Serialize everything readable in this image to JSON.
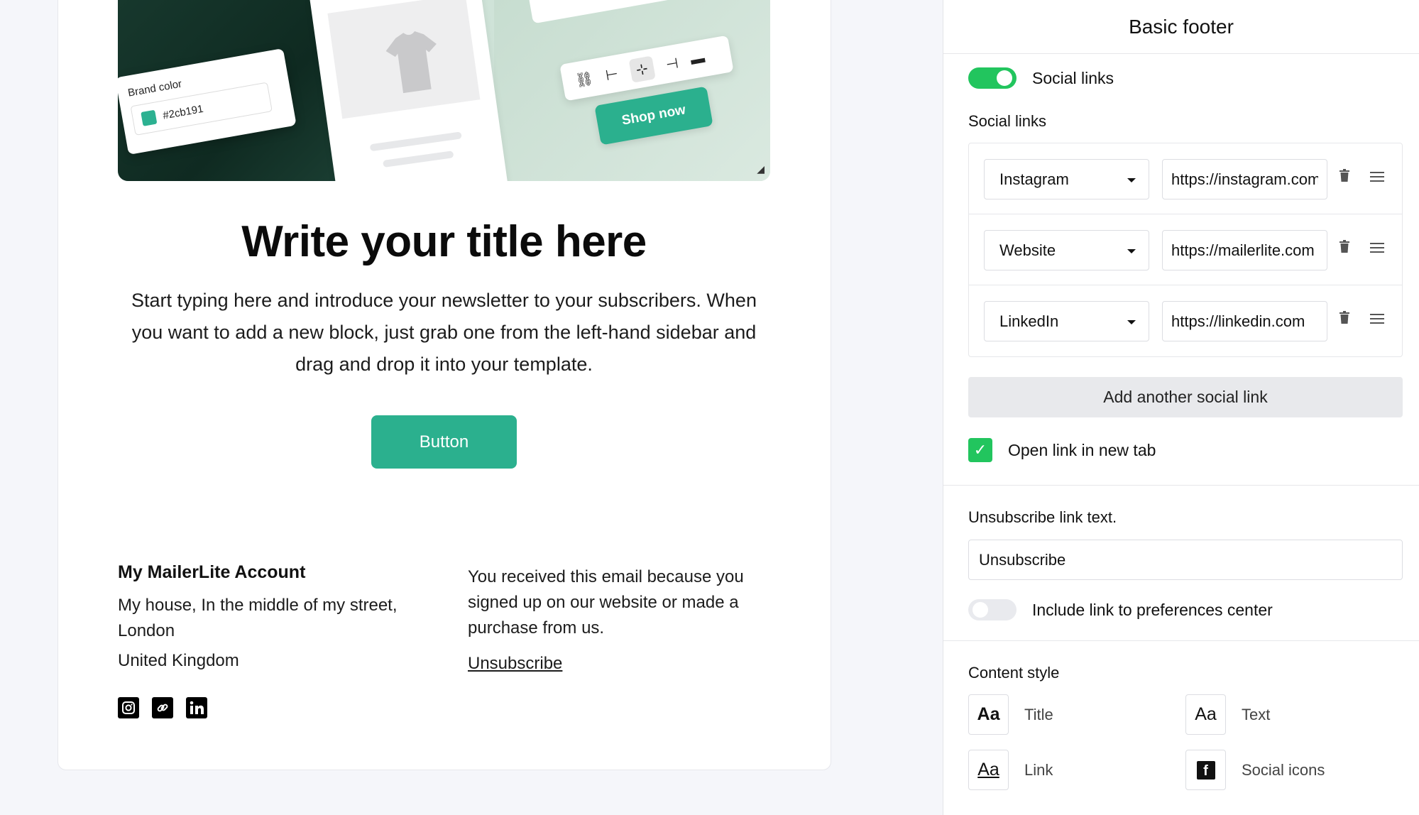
{
  "hero": {
    "brand_color_label": "Brand color",
    "brand_color_value": "#2cb191",
    "shop_button": "Shop now",
    "brand_color_hex": "#2cb191"
  },
  "email": {
    "title": "Write your title here",
    "body": "Start typing here and introduce your newsletter to your subscribers. When you want to add a new block, just grab one from the left-hand sidebar and drag and drop it into your template.",
    "button": "Button",
    "footer": {
      "account": "My MailerLite Account",
      "address": "My house, In the middle of my street, London",
      "country": "United Kingdom",
      "notice": "You received this email because you signed up on our website or made a purchase from us.",
      "unsubscribe": "Unsubscribe",
      "social_icons": [
        "instagram-icon",
        "link-icon",
        "linkedin-icon"
      ]
    }
  },
  "panel": {
    "title": "Basic footer",
    "social_toggle_label": "Social links",
    "social_toggle_on": true,
    "social_section_label": "Social links",
    "links": [
      {
        "network": "Instagram",
        "url": "https://instagram.com"
      },
      {
        "network": "Website",
        "url": "https://mailerlite.com"
      },
      {
        "network": "LinkedIn",
        "url": "https://linkedin.com"
      }
    ],
    "add_link_button": "Add another social link",
    "open_new_tab_label": "Open link in new tab",
    "open_new_tab_checked": true,
    "unsubscribe_label": "Unsubscribe link text.",
    "unsubscribe_value": "Unsubscribe",
    "preferences_label": "Include link to preferences center",
    "preferences_on": false,
    "content_style_label": "Content style",
    "styles": {
      "title": {
        "preview": "Aa",
        "label": "Title"
      },
      "text": {
        "preview": "Aa",
        "label": "Text"
      },
      "link": {
        "preview": "Aa",
        "label": "Link"
      },
      "social": {
        "preview": "f",
        "label": "Social icons"
      }
    }
  },
  "colors": {
    "accent": "#2bb08e",
    "toggle_green": "#22c55e"
  }
}
